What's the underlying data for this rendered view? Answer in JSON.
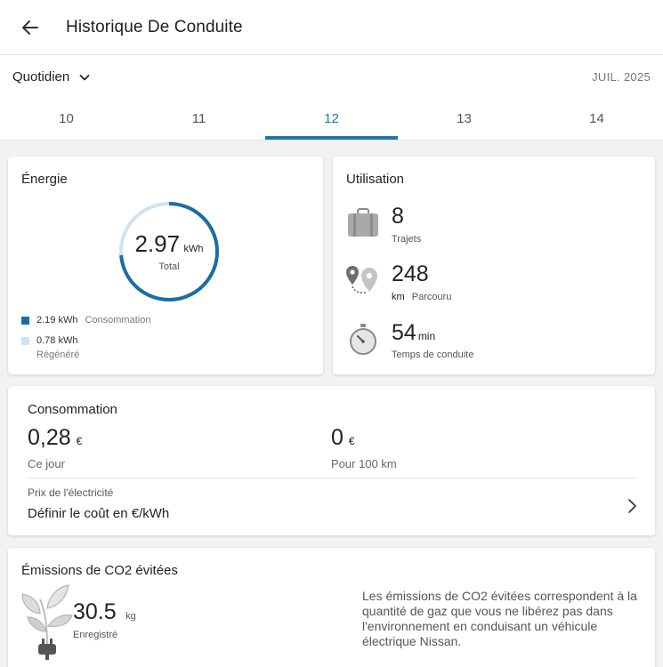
{
  "header": {
    "title": "Historique De Conduite"
  },
  "period": {
    "selector_label": "Quotidien",
    "month": "JUIL. 2025",
    "days": [
      "10",
      "11",
      "12",
      "13",
      "14"
    ],
    "active_index": 2
  },
  "energy": {
    "title": "Énergie",
    "total_value": "2.97",
    "total_unit": "kWh",
    "total_label": "Total",
    "consumption_fraction": 0.737,
    "consumption_value": "2.19 kWh",
    "consumption_label": "Consommation",
    "regenerated_value": "0.78 kWh",
    "regenerated_label": "Régénéré"
  },
  "usage": {
    "title": "Utilisation",
    "trips_value": "8",
    "trips_label": "Trajets",
    "distance_value": "248",
    "distance_unit": "km",
    "distance_label": "Parcouru",
    "time_value": "54",
    "time_unit": "min",
    "time_label": "Temps de conduite"
  },
  "consumption": {
    "title": "Consommation",
    "day_value": "0,28",
    "day_currency": "€",
    "day_label": "Ce jour",
    "per100_value": "0",
    "per100_currency": "€",
    "per100_label": "Pour 100 km",
    "price_label": "Prix de l'électricité",
    "price_action": "Définir le coût en €/kWh"
  },
  "co2": {
    "title": "Émissions de CO2 évitées",
    "value": "30.5",
    "unit": "kg",
    "label": "Enregistré",
    "description": "Les émissions de CO2 évitées correspondent à la quantité de gaz que vous ne libérez pas dans l'environnement en conduisant un véhicule électrique Nissan."
  },
  "colors": {
    "accent": "#1f78a6",
    "ring_consumption": "#1a6ea3",
    "ring_regenerated": "#cfe3f2"
  }
}
